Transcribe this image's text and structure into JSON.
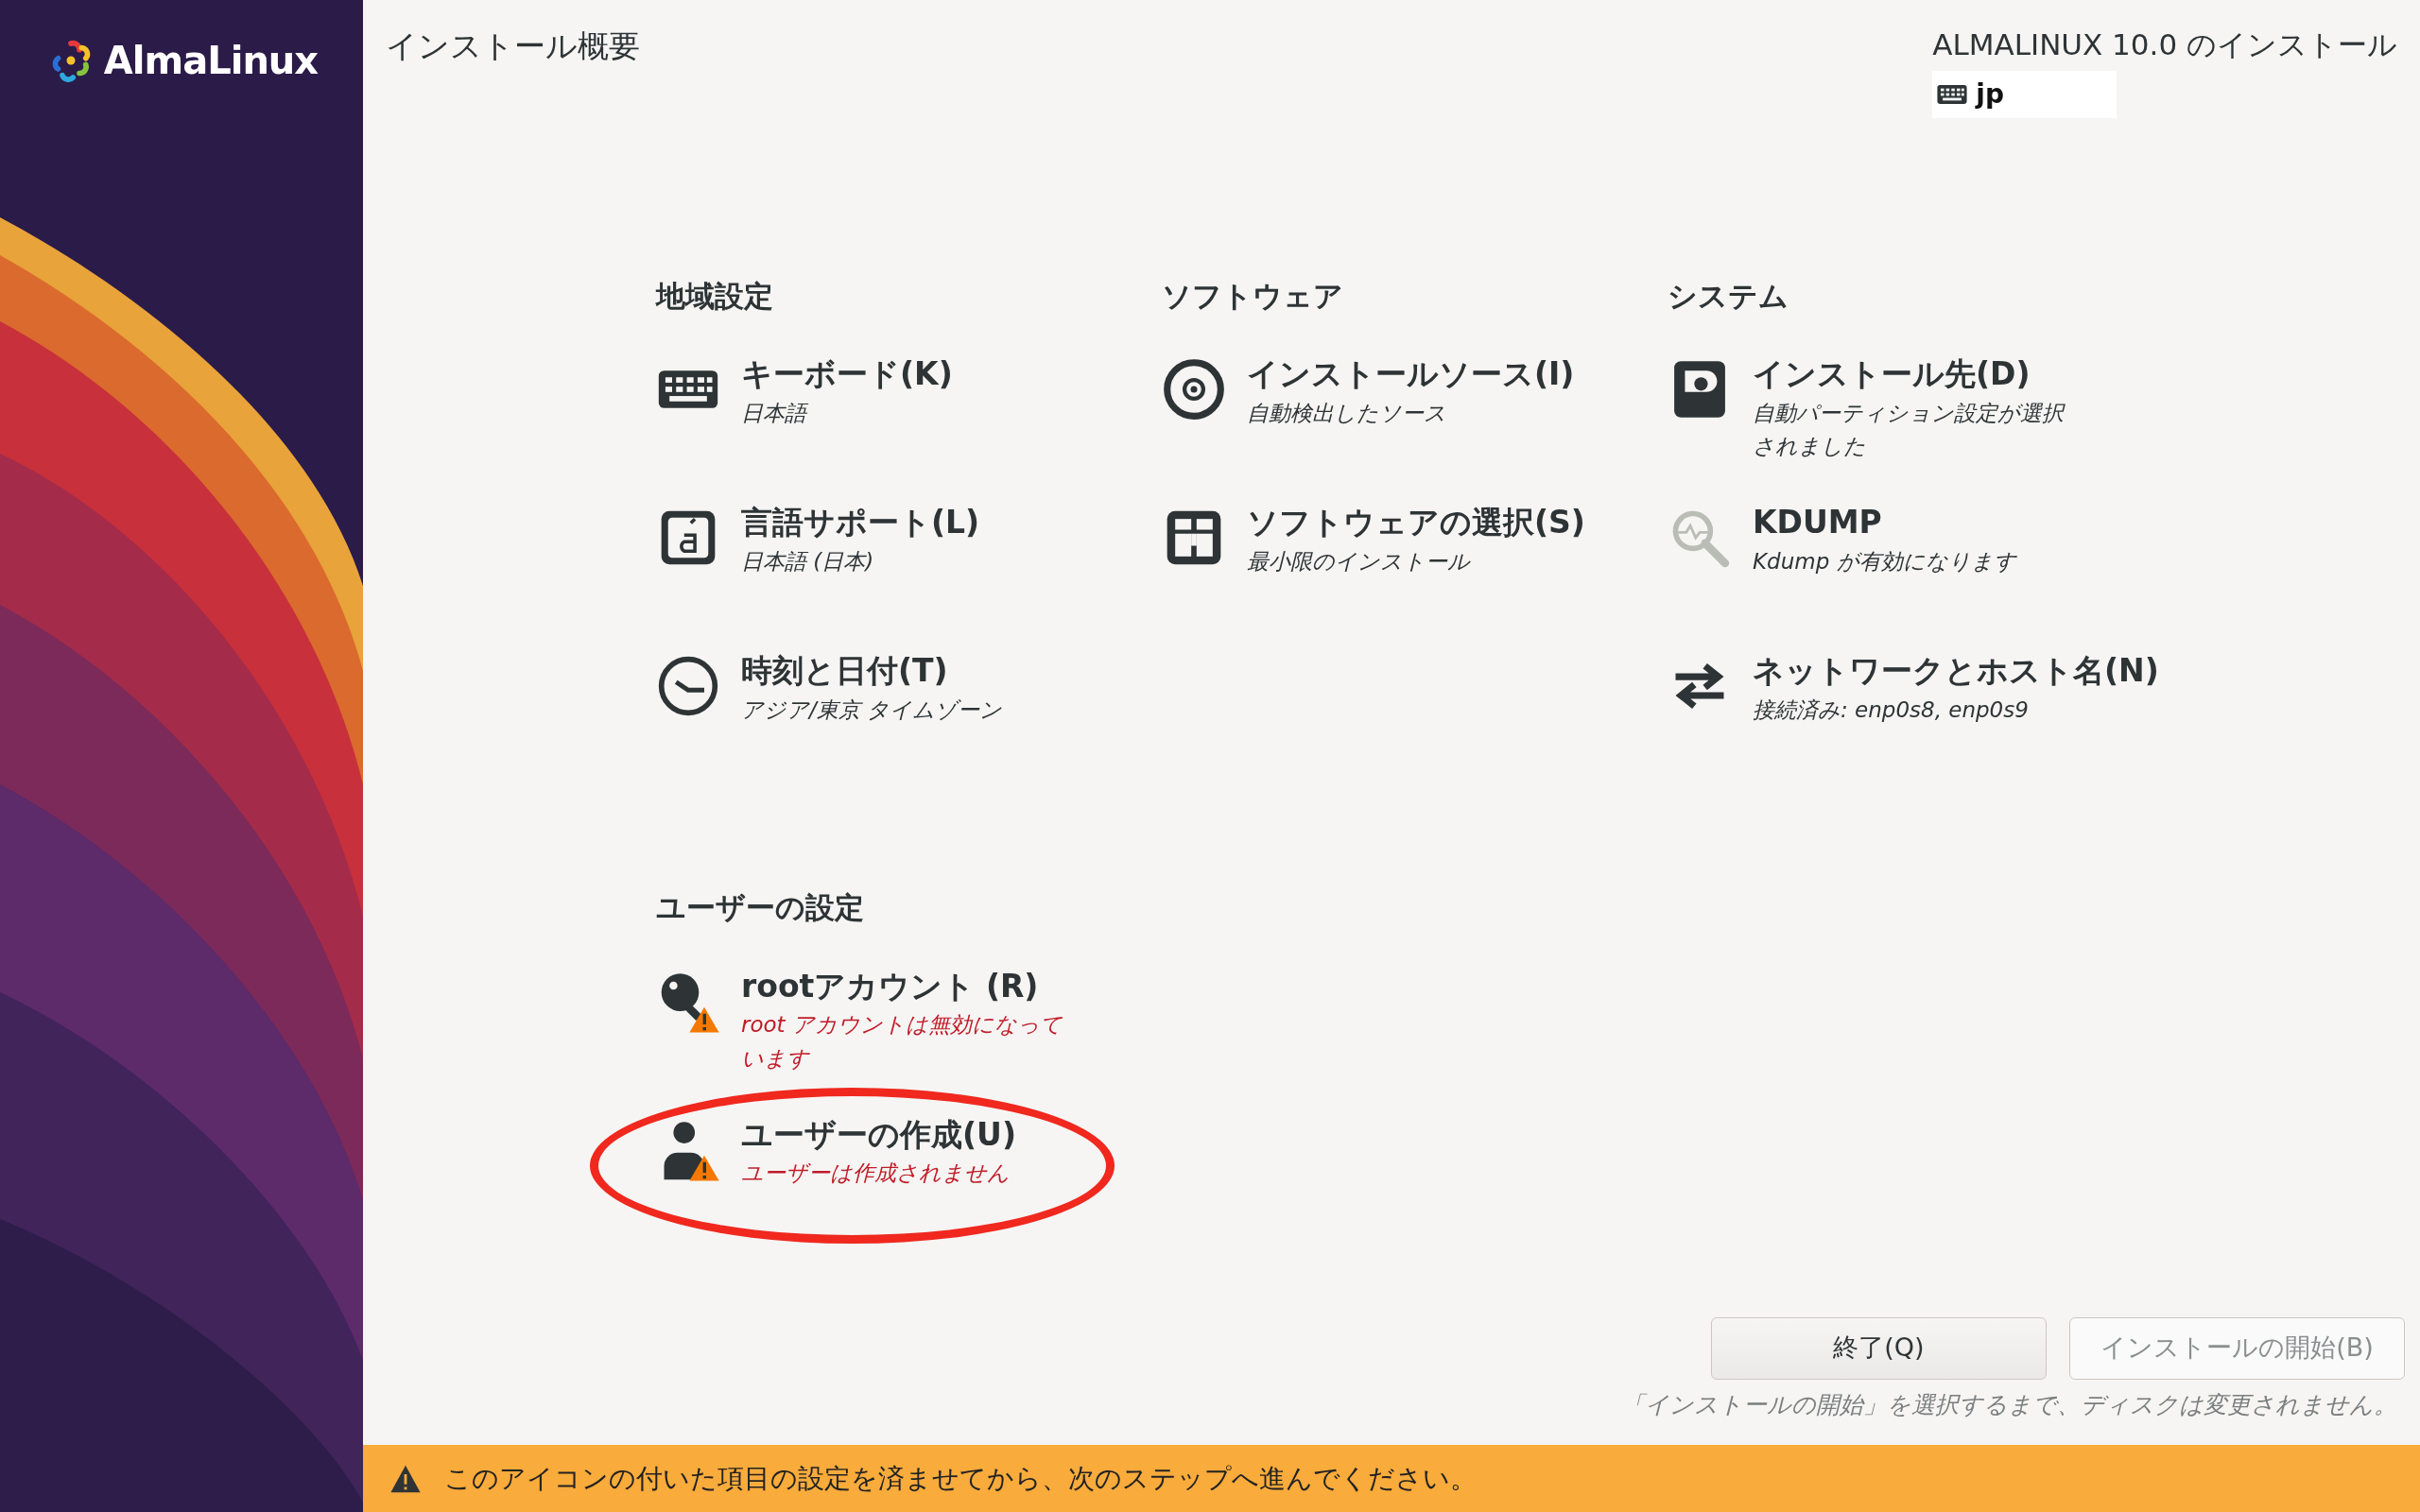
{
  "sidebar": {
    "logo_text": "AlmaLinux"
  },
  "header": {
    "title": "インストール概要",
    "product": "ALMALINUX 10.0 のインストール",
    "keyboard_layout": "jp"
  },
  "sections": [
    {
      "title": "地域設定",
      "spokes": [
        {
          "kind": "keyboard",
          "title": "キーボード(K)",
          "status": "日本語",
          "warning": false,
          "circled": false
        },
        {
          "kind": "language",
          "title": "言語サポート(L)",
          "status": "日本語 (日本)",
          "warning": false,
          "circled": false
        },
        {
          "kind": "clock",
          "title": "時刻と日付(T)",
          "status": "アジア/東京 タイムゾーン",
          "warning": false,
          "circled": false
        }
      ]
    },
    {
      "title": "ソフトウェア",
      "spokes": [
        {
          "kind": "disc",
          "title": "インストールソース(I)",
          "status": "自動検出したソース",
          "warning": false,
          "circled": false
        },
        {
          "kind": "package",
          "title": "ソフトウェアの選択(S)",
          "status": "最小限のインストール",
          "warning": false,
          "circled": false
        }
      ]
    },
    {
      "title": "システム",
      "spokes": [
        {
          "kind": "drive",
          "title": "インストール先(D)",
          "status": "自動パーティション設定が選択されました",
          "warning": false,
          "circled": false
        },
        {
          "kind": "magnifier",
          "title": "KDUMP",
          "status": "Kdump が有効になります",
          "warning": false,
          "circled": false
        },
        {
          "kind": "arrows",
          "title": "ネットワークとホスト名(N)",
          "status": "接続済み: enp0s8, enp0s9",
          "warning": false,
          "circled": false
        }
      ]
    },
    {
      "title": "ユーザーの設定",
      "spokes": [
        {
          "kind": "key",
          "title": "rootアカウント (R)",
          "status": "root アカウントは無効になっています",
          "warning": true,
          "circled": false
        },
        {
          "kind": "person",
          "title": "ユーザーの作成(U)",
          "status": "ユーザーは作成されません",
          "warning": true,
          "circled": true
        }
      ]
    }
  ],
  "buttons": [
    {
      "label": "終了(Q)",
      "disabled": false
    },
    {
      "label": "インストールの開始(B)",
      "disabled": true
    }
  ],
  "note": "「インストールの開始」を選択するまで、ディスクは変更されません。",
  "warning_bar": {
    "message": "このアイコンの付いた項目の設定を済ませてから、次のステップへ進んでください。"
  }
}
